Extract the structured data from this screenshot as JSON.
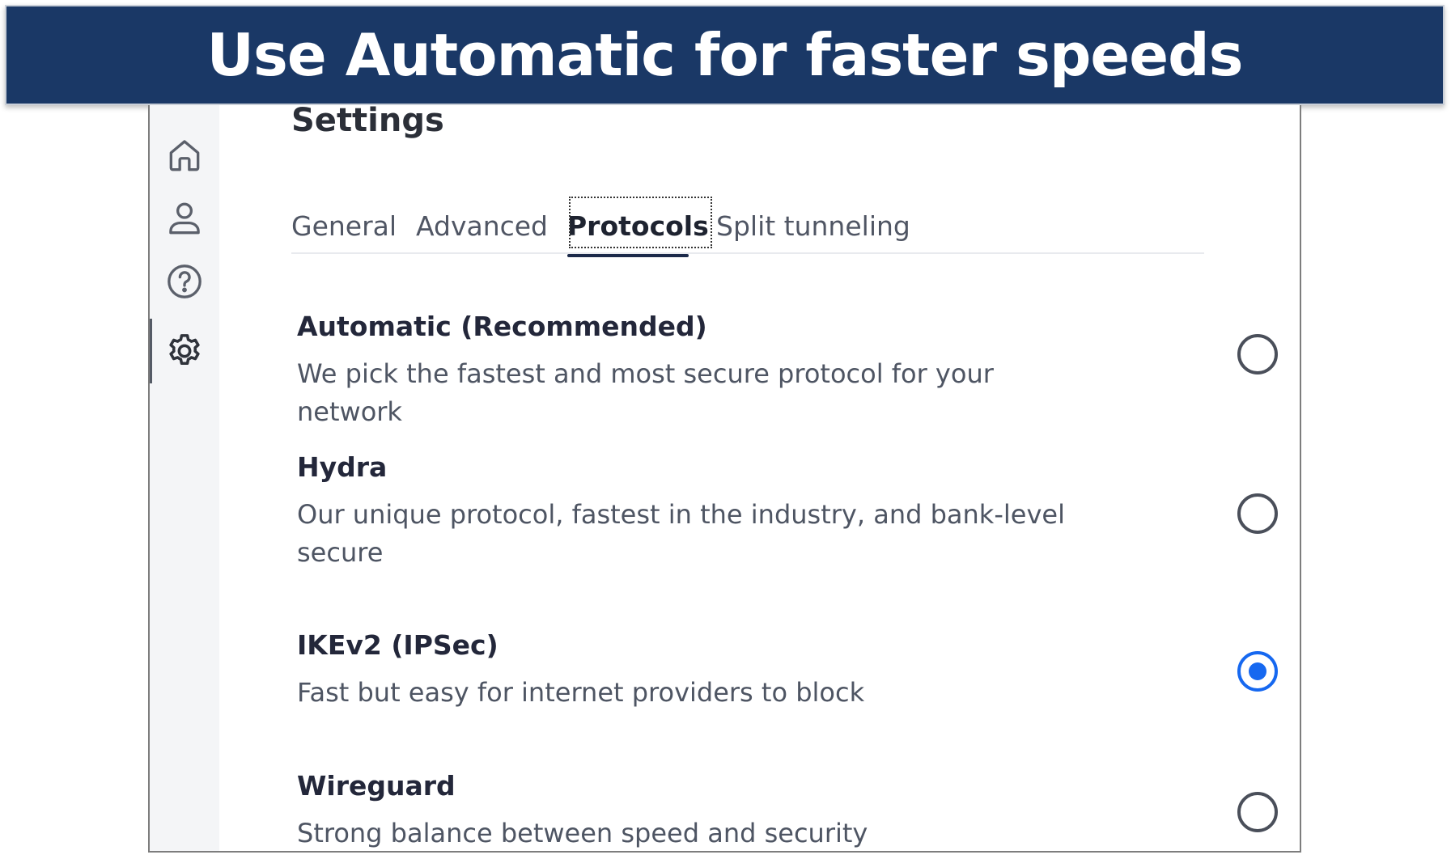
{
  "banner": {
    "title": "Use Automatic for faster speeds",
    "bg_color": "#1a3866"
  },
  "sidebar": {
    "items": [
      {
        "name": "home",
        "icon": "home-icon"
      },
      {
        "name": "account",
        "icon": "user-icon"
      },
      {
        "name": "help",
        "icon": "help-circle-icon"
      },
      {
        "name": "settings",
        "icon": "gear-icon",
        "active": true
      }
    ]
  },
  "page": {
    "title": "Settings"
  },
  "tabs": [
    {
      "label": "General"
    },
    {
      "label": "Advanced"
    },
    {
      "label": "Protocols",
      "active": true
    },
    {
      "label": "Split tunneling"
    }
  ],
  "protocols": [
    {
      "title": "Automatic (Recommended)",
      "description": "We pick the fastest and most secure protocol for your network",
      "selected": false
    },
    {
      "title": "Hydra",
      "description": "Our unique protocol, fastest in the industry, and bank-level secure",
      "selected": false
    },
    {
      "title": "IKEv2 (IPSec)",
      "description": "Fast but easy for internet providers to block",
      "selected": true
    },
    {
      "title": "Wireguard",
      "description": "Strong balance between speed and security",
      "selected": false
    }
  ],
  "colors": {
    "accent": "#1668f0",
    "text_dark": "#23273a",
    "text_muted": "#4e5563"
  }
}
